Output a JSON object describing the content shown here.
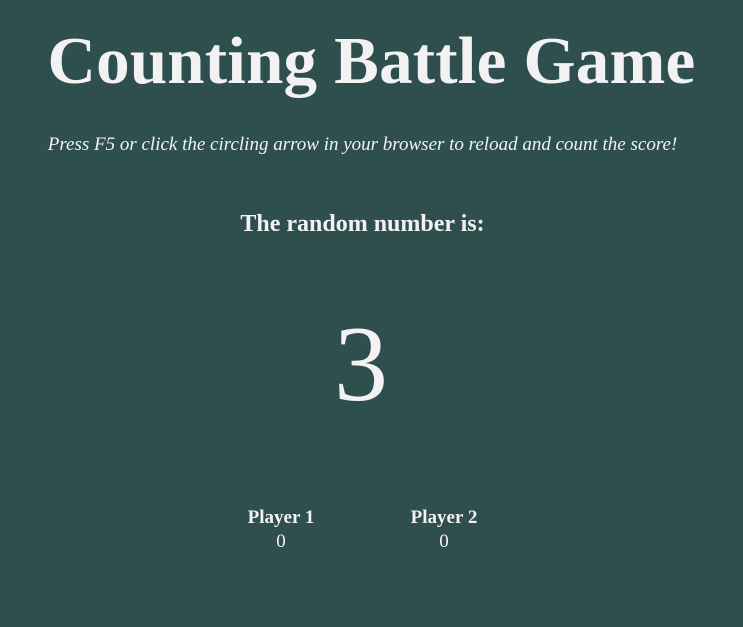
{
  "title": "Counting Battle Game",
  "subtitle": "Press F5 or click the circling arrow in your browser to reload and count the score!",
  "number_heading": "The random number is:",
  "random_number": "3",
  "players": [
    {
      "label": "Player 1",
      "score": "0"
    },
    {
      "label": "Player 2",
      "score": "0"
    }
  ],
  "colors": {
    "background": "#2f4f4f",
    "text": "#f2f2f2"
  }
}
